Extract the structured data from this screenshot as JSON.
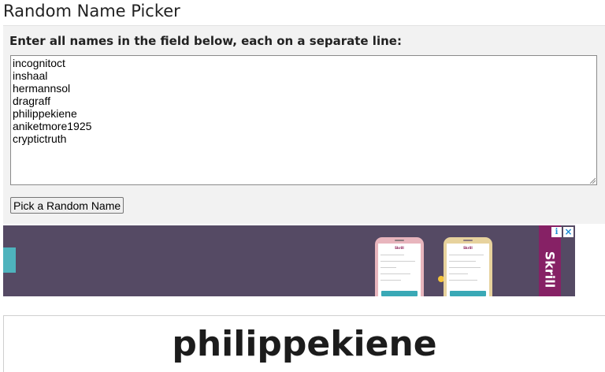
{
  "page": {
    "title": "Random Name Picker"
  },
  "form": {
    "label": "Enter all names in the field below, each on a separate line:",
    "names": [
      "incognitoct",
      "inshaal",
      "hermannsol",
      "dragraff",
      "philippekiene",
      "aniketmore1925",
      "cryptictruth"
    ],
    "button_label": "Pick a Random Name"
  },
  "ad": {
    "brand": "Skrill",
    "phone_brand": "Skrill",
    "info_icon": "info-icon",
    "close_icon": "close-icon",
    "colors": {
      "background": "#554a64",
      "brand": "#862165",
      "accent": "#4eb3bd"
    }
  },
  "result": {
    "picked_name": "philippekiene"
  }
}
